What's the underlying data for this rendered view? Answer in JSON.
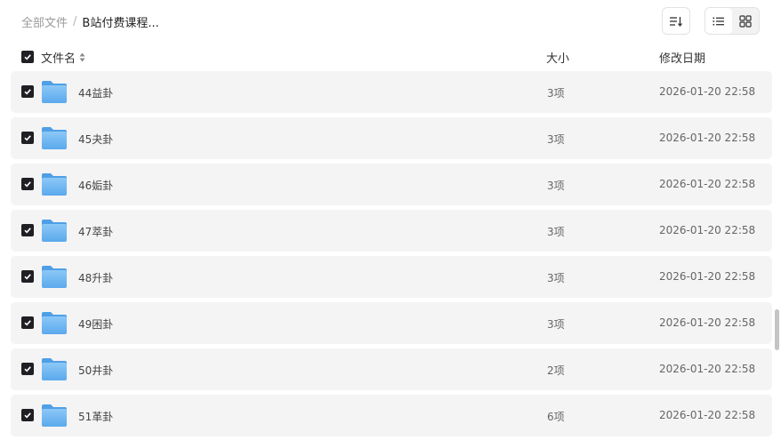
{
  "breadcrumb": {
    "root": "全部文件",
    "separator": "/",
    "current": "B站付费课程..."
  },
  "toolbar": {
    "sort_icon": "sort-lines-icon",
    "view_list_icon": "list-view-icon",
    "view_grid_icon": "grid-view-icon",
    "active_view": "list"
  },
  "columns": {
    "name": "文件名",
    "size": "大小",
    "date": "修改日期"
  },
  "rows": [
    {
      "name": "44益卦",
      "size": "3项",
      "date": "2026-01-20 22:58",
      "checked": true
    },
    {
      "name": "45夬卦",
      "size": "3项",
      "date": "2026-01-20 22:58",
      "checked": true
    },
    {
      "name": "46姤卦",
      "size": "3项",
      "date": "2026-01-20 22:58",
      "checked": true
    },
    {
      "name": "47萃卦",
      "size": "3项",
      "date": "2026-01-20 22:58",
      "checked": true
    },
    {
      "name": "48升卦",
      "size": "3项",
      "date": "2026-01-20 22:58",
      "checked": true
    },
    {
      "name": "49困卦",
      "size": "3项",
      "date": "2026-01-20 22:58",
      "checked": true
    },
    {
      "name": "50井卦",
      "size": "2项",
      "date": "2026-01-20 22:58",
      "checked": true
    },
    {
      "name": "51革卦",
      "size": "6项",
      "date": "2026-01-20 22:58",
      "checked": true
    }
  ],
  "colors": {
    "row_bg": "#f4f4f4",
    "checkbox": "#1f1f24",
    "folder": "#6fb6f0"
  }
}
